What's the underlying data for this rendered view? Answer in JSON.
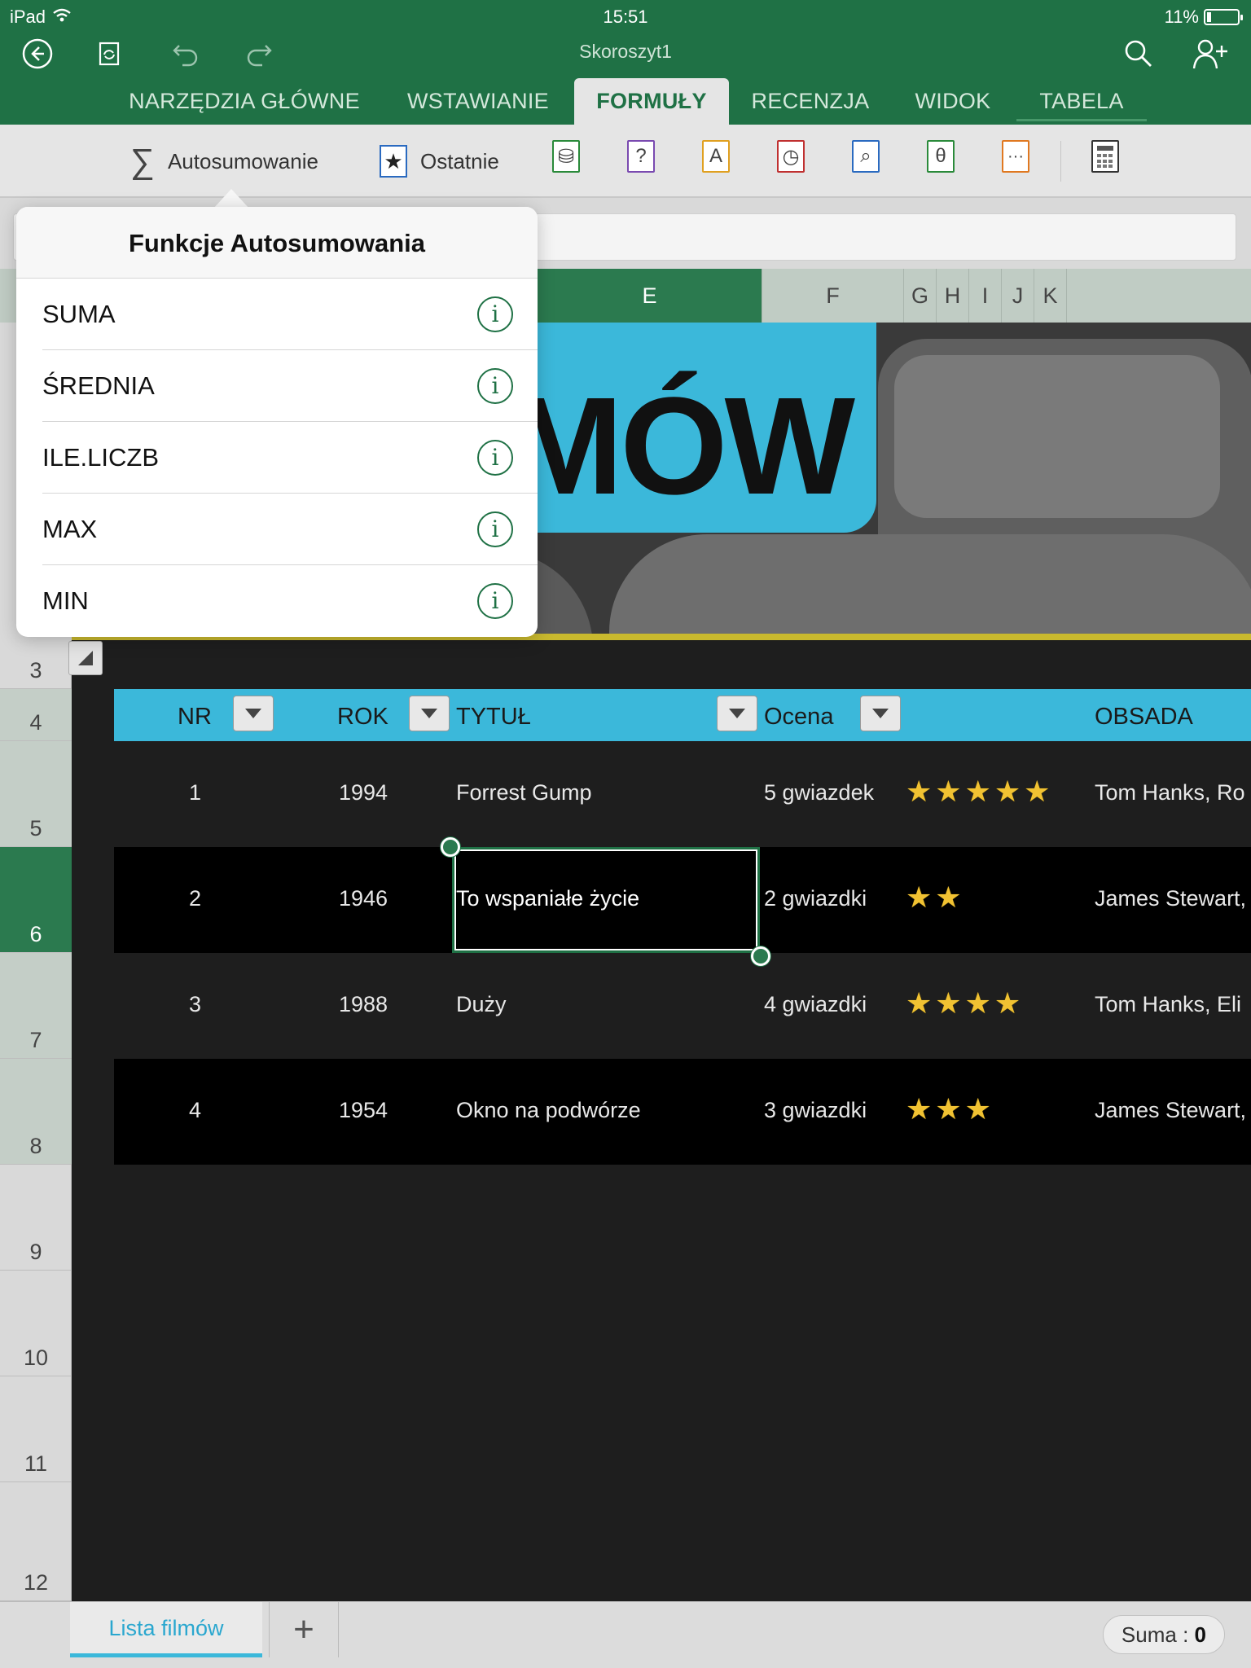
{
  "status_bar": {
    "device": "iPad",
    "time": "15:51",
    "battery": "11%"
  },
  "app": {
    "title": "Skoroszyt1"
  },
  "tabs": [
    {
      "label": "NARZĘDZIA GŁÓWNE"
    },
    {
      "label": "WSTAWIANIE"
    },
    {
      "label": "FORMUŁY",
      "active": true
    },
    {
      "label": "RECENZJA"
    },
    {
      "label": "WIDOK"
    },
    {
      "label": "TABELA"
    }
  ],
  "ribbon": {
    "autosum_label": "Autosumowanie",
    "recent_label": "Ostatnie",
    "function_categories": [
      {
        "icon": "financial-icon",
        "glyph": "⛁",
        "color": "#2a8a3a"
      },
      {
        "icon": "logical-icon",
        "glyph": "?",
        "color": "#7a4ab0"
      },
      {
        "icon": "text-icon",
        "glyph": "A",
        "color": "#e0a020"
      },
      {
        "icon": "date-time-icon",
        "glyph": "◷",
        "color": "#c03030"
      },
      {
        "icon": "lookup-icon",
        "glyph": "⌕",
        "color": "#2a6ac0"
      },
      {
        "icon": "math-icon",
        "glyph": "θ",
        "color": "#2a8a3a"
      },
      {
        "icon": "more-functions-icon",
        "glyph": "···",
        "color": "#e07820"
      }
    ]
  },
  "grid": {
    "columns": [
      "E",
      "F",
      "G",
      "H",
      "I",
      "J",
      "K"
    ],
    "selected_column": "E",
    "rows": [
      "3",
      "4",
      "5",
      "6",
      "7",
      "8",
      "9",
      "10",
      "11",
      "12"
    ],
    "selected_row": "6"
  },
  "banner": {
    "text": "LMÓW"
  },
  "table": {
    "headers": {
      "nr": "NR",
      "rok": "ROK",
      "title": "TYTUŁ",
      "rating": "Ocena",
      "cast": "OBSADA"
    },
    "rows": [
      {
        "nr": "1",
        "rok": "1994",
        "title": "Forrest Gump",
        "rating": "5 gwiazdek",
        "stars": 5,
        "cast": "Tom Hanks, Ro"
      },
      {
        "nr": "2",
        "rok": "1946",
        "title": "To wspaniałe życie",
        "rating": "2 gwiazdki",
        "stars": 2,
        "cast": "James Stewart,"
      },
      {
        "nr": "3",
        "rok": "1988",
        "title": "Duży",
        "rating": "4 gwiazdki",
        "stars": 4,
        "cast": "Tom Hanks, Eli"
      },
      {
        "nr": "4",
        "rok": "1954",
        "title": "Okno na podwórze",
        "rating": "3 gwiazdki",
        "stars": 3,
        "cast": "James Stewart,"
      }
    ],
    "selected_cell_title": "To wspaniałe życie"
  },
  "popover": {
    "title": "Funkcje Autosumowania",
    "items": [
      "SUMA",
      "ŚREDNIA",
      "ILE.LICZB",
      "MAX",
      "MIN"
    ],
    "info_glyph": "i"
  },
  "bottom": {
    "sheet_tab": "Lista filmów",
    "add_glyph": "+",
    "sum_label": "Suma :",
    "sum_value": "0"
  },
  "colors": {
    "accent": "#1f7145",
    "table_header": "#3bb8da",
    "star": "#f1c232"
  }
}
